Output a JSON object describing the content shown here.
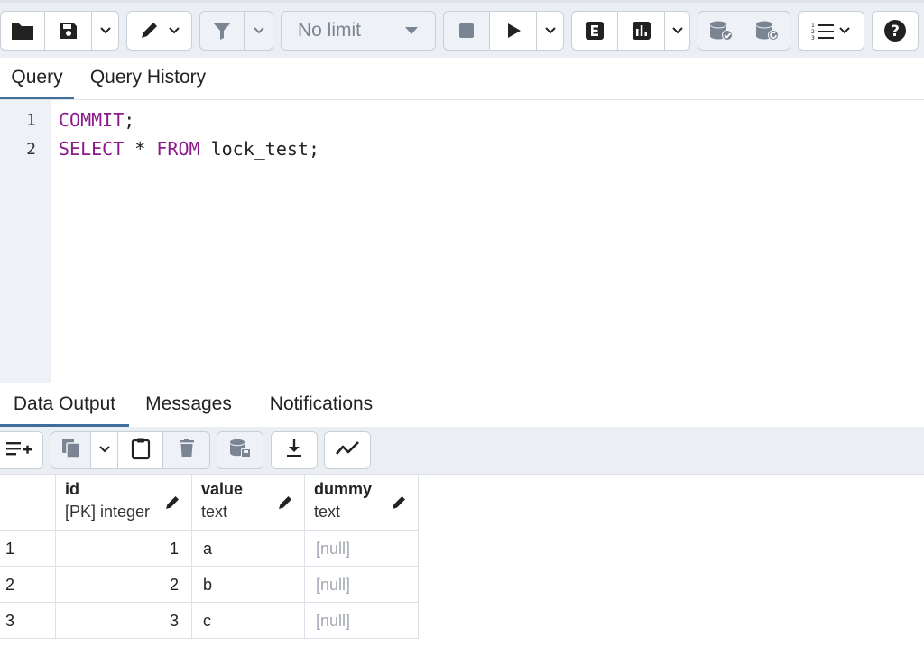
{
  "toolbar": {
    "limit_label": "No limit"
  },
  "query_tabs": {
    "query": "Query",
    "history": "Query History"
  },
  "editor": {
    "lines": [
      {
        "num": "1",
        "kw1": "COMMIT",
        "rest1": ";"
      },
      {
        "num": "2",
        "kw1": "SELECT",
        "mid": " * ",
        "kw2": "FROM",
        "rest2": " lock_test;"
      }
    ]
  },
  "output_tabs": {
    "data_output": "Data Output",
    "messages": "Messages",
    "notifications": "Notifications"
  },
  "grid": {
    "columns": [
      {
        "name": "id",
        "type": "[PK] integer"
      },
      {
        "name": "value",
        "type": "text"
      },
      {
        "name": "dummy",
        "type": "text"
      }
    ],
    "rows": [
      {
        "rownum": "1",
        "id": "1",
        "value": "a",
        "dummy": "[null]"
      },
      {
        "rownum": "2",
        "id": "2",
        "value": "b",
        "dummy": "[null]"
      },
      {
        "rownum": "3",
        "id": "3",
        "value": "c",
        "dummy": "[null]"
      }
    ]
  },
  "colors": {
    "keyword": "#8b1a8b",
    "active_tab_underline": "#3e6e99",
    "toolbar_bg": "#ebeef3"
  }
}
